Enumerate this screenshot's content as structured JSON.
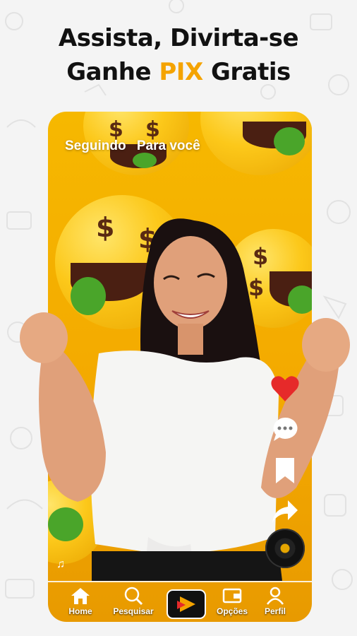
{
  "headline": {
    "line1": "Assista, Divirta-se",
    "line2_prefix": "Ganhe ",
    "line2_accent": "PIX",
    "line2_suffix": " Gratis"
  },
  "colors": {
    "accent": "#f4a300",
    "like": "#e62a2a",
    "background_yellow": "#f6b800"
  },
  "top_nav": {
    "following": "Seguindo",
    "for_you": "Para você"
  },
  "side_actions": [
    {
      "name": "like",
      "icon": "heart-icon"
    },
    {
      "name": "comments",
      "icon": "chat-bubble-icon"
    },
    {
      "name": "save",
      "icon": "bookmark-icon"
    },
    {
      "name": "share",
      "icon": "share-arrow-icon"
    }
  ],
  "music": {
    "icon": "music-note-icon",
    "disc_icon": "vinyl-disc-icon"
  },
  "bottom_tabs": {
    "home": "Home",
    "search": "Pesquisar",
    "options": "Opções",
    "profile": "Perfil",
    "center_icon": "play-logo-icon"
  }
}
